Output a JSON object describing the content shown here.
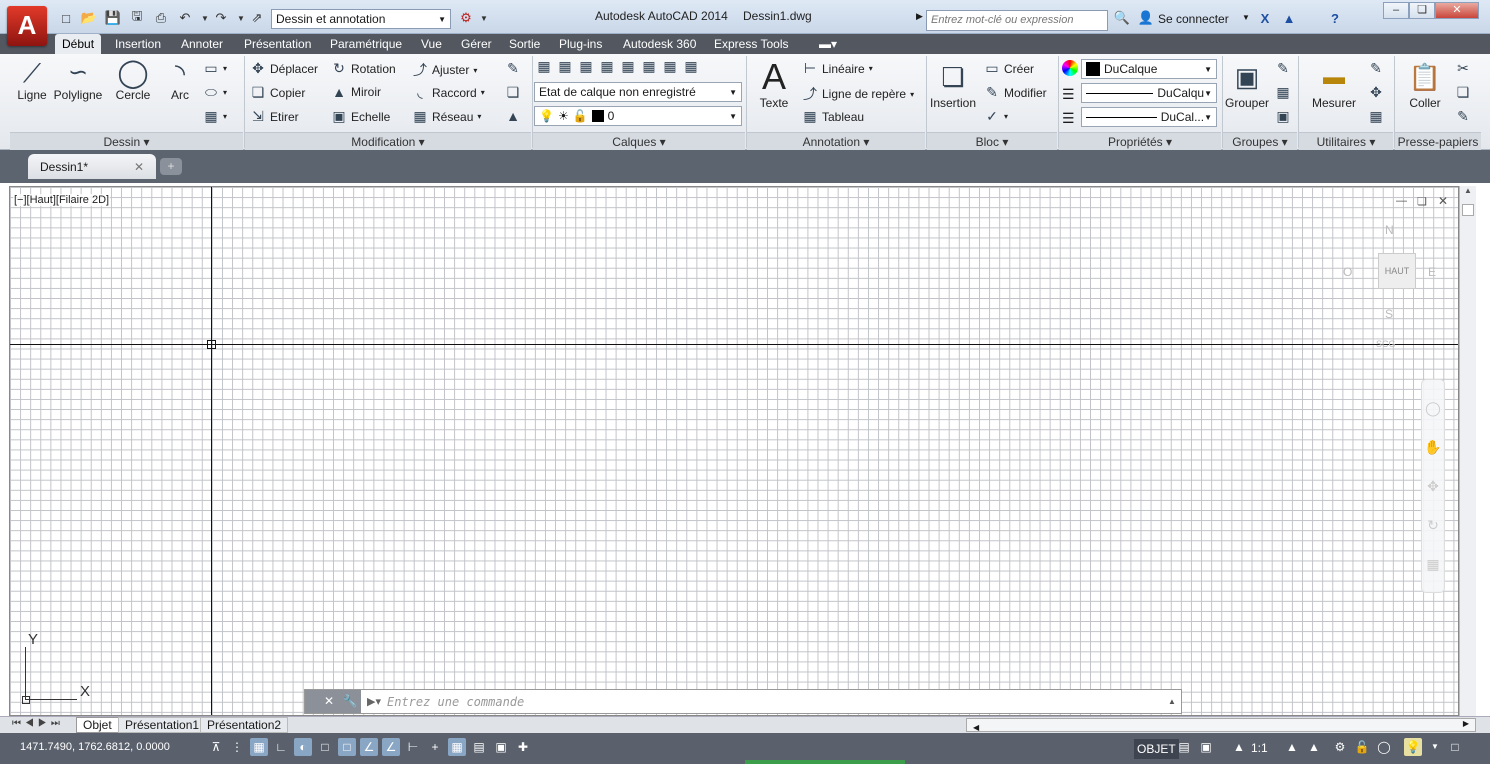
{
  "app": {
    "title": "Autodesk AutoCAD 2014",
    "file": "Dessin1.dwg",
    "logo": "A"
  },
  "workspace": {
    "selected": "Dessin et annotation"
  },
  "search": {
    "placeholder": "Entrez mot-clé ou expression"
  },
  "account": {
    "label": "Se connecter"
  },
  "menu_tabs": [
    "Début",
    "Insertion",
    "Annoter",
    "Présentation",
    "Paramétrique",
    "Vue",
    "Gérer",
    "Sortie",
    "Plug-ins",
    "Autodesk 360",
    "Express Tools"
  ],
  "ribbon": {
    "dessin": {
      "title": "Dessin",
      "ligne": "Ligne",
      "polyligne": "Polyligne",
      "cercle": "Cercle",
      "arc": "Arc"
    },
    "modification": {
      "title": "Modification",
      "deplacer": "Déplacer",
      "rotation": "Rotation",
      "ajuster": "Ajuster",
      "copier": "Copier",
      "miroir": "Miroir",
      "raccord": "Raccord",
      "etirer": "Etirer",
      "echelle": "Echelle",
      "reseau": "Réseau"
    },
    "calques": {
      "title": "Calques",
      "etat": "Etat de calque non enregistré",
      "current": "0"
    },
    "annotation": {
      "title": "Annotation",
      "texte": "Texte",
      "lineaire": "Linéaire",
      "ligne_repere": "Ligne de repère",
      "tableau": "Tableau"
    },
    "bloc": {
      "title": "Bloc",
      "insertion": "Insertion",
      "creer": "Créer",
      "modifier": "Modifier"
    },
    "proprietes": {
      "title": "Propriétés",
      "color": "DuCalque",
      "linetype": "DuCalqu",
      "lineweight": "DuCal..."
    },
    "groupes": {
      "title": "Groupes",
      "grouper": "Grouper"
    },
    "utilitaires": {
      "title": "Utilitaires",
      "mesurer": "Mesurer"
    },
    "presse": {
      "title": "Presse-papiers",
      "coller": "Coller"
    }
  },
  "doc_tabs": [
    "Dessin1*"
  ],
  "viewport": {
    "label": "[−][Haut][Filaire 2D]",
    "viewcube": {
      "top": "HAUT",
      "n": "N",
      "s": "S",
      "e": "E",
      "w": "O",
      "scg": "SCG"
    },
    "ucs_x": "X",
    "ucs_y": "Y"
  },
  "command": {
    "placeholder": "Entrez une commande"
  },
  "layout_tabs": [
    "Objet",
    "Présentation1",
    "Présentation2"
  ],
  "status": {
    "coords": "1471.7490, 1762.6812, 0.0000",
    "objet": "OBJET",
    "scale": "1:1"
  }
}
